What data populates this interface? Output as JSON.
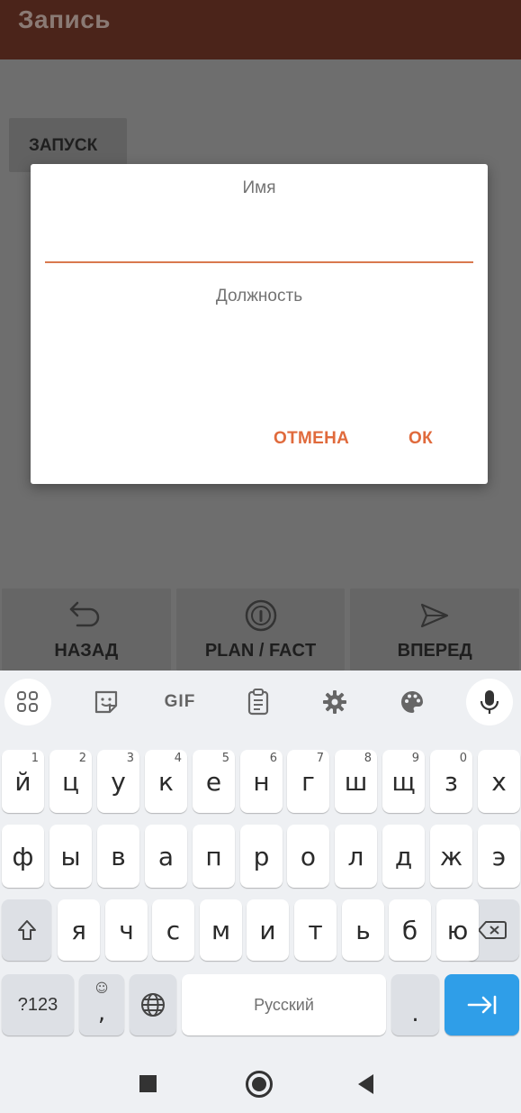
{
  "appbar": {
    "title": "Запись"
  },
  "main": {
    "launch_label": "ЗАПУСК"
  },
  "bottom_nav": {
    "back_label": "НАЗАД",
    "plan_fact_label": "PLAN / FACT",
    "forward_label": "ВПЕРЕД"
  },
  "dialog": {
    "name_label": "Имя",
    "name_value": "",
    "position_label": "Должность",
    "cancel_label": "ОТМЕНА",
    "ok_label": "ОК",
    "accent_color": "#e06a3c"
  },
  "keyboard": {
    "toolbar": {
      "gif_label": "GIF"
    },
    "row1": [
      {
        "k": "й",
        "h": "1"
      },
      {
        "k": "ц",
        "h": "2"
      },
      {
        "k": "у",
        "h": "3"
      },
      {
        "k": "к",
        "h": "4"
      },
      {
        "k": "е",
        "h": "5"
      },
      {
        "k": "н",
        "h": "6"
      },
      {
        "k": "г",
        "h": "7"
      },
      {
        "k": "ш",
        "h": "8"
      },
      {
        "k": "щ",
        "h": "9"
      },
      {
        "k": "з",
        "h": "0"
      },
      {
        "k": "х",
        "h": ""
      }
    ],
    "row2": [
      "ф",
      "ы",
      "в",
      "а",
      "п",
      "р",
      "о",
      "л",
      "д",
      "ж",
      "э"
    ],
    "row3": [
      "я",
      "ч",
      "с",
      "м",
      "и",
      "т",
      "ь",
      "б",
      "ю"
    ],
    "symbols_label": "?123",
    "comma_label": ",",
    "space_label": "Русский",
    "period_label": ".",
    "action_color": "#2f9ee8"
  }
}
